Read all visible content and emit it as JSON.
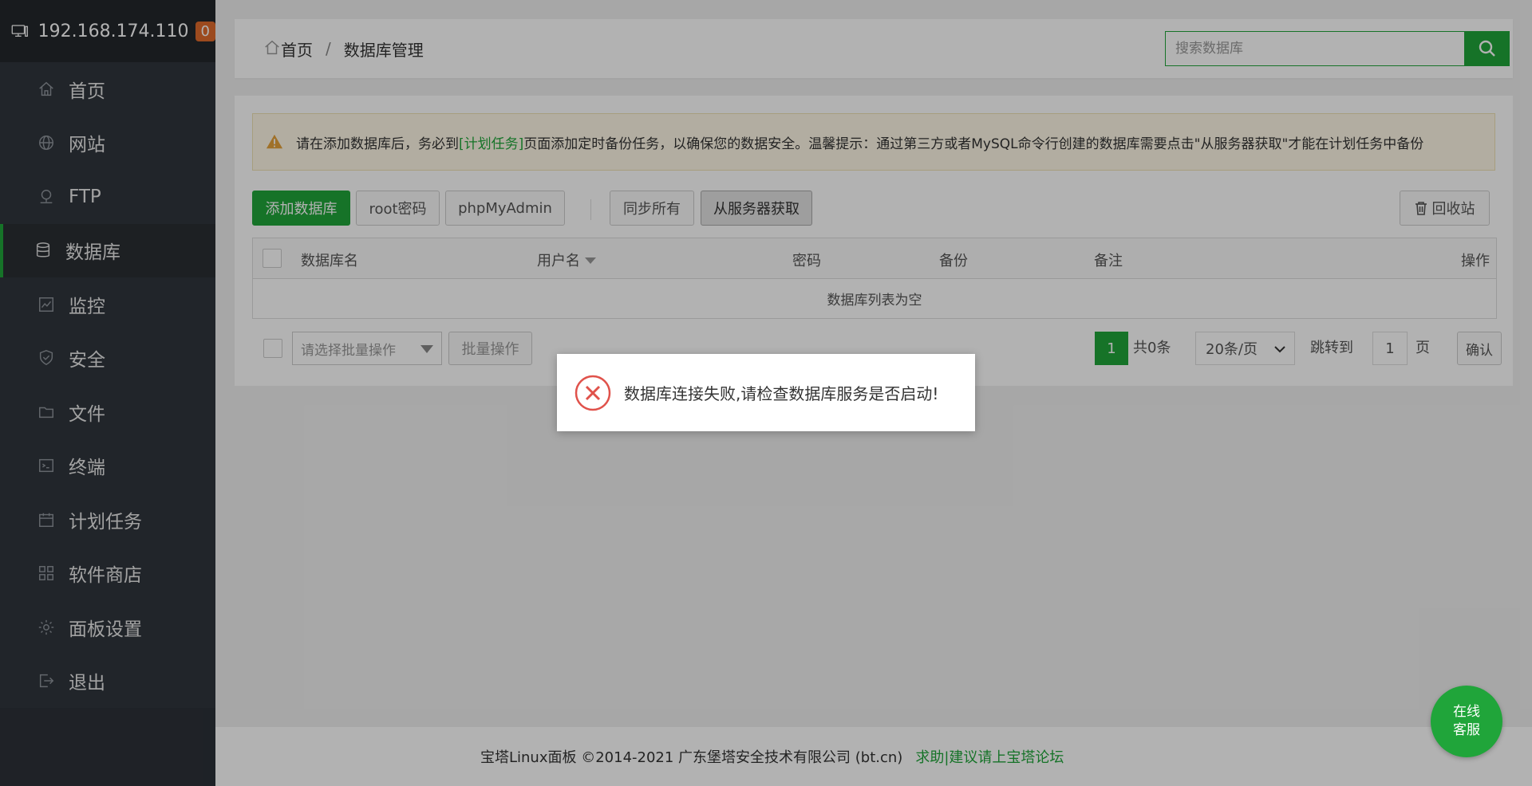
{
  "header": {
    "ip": "192.168.174.110",
    "badge_count": "0"
  },
  "menu": [
    {
      "label": "首页",
      "icon": "home-icon"
    },
    {
      "label": "网站",
      "icon": "globe-icon"
    },
    {
      "label": "FTP",
      "icon": "ftp-icon"
    },
    {
      "label": "数据库",
      "icon": "database-icon",
      "active": true
    },
    {
      "label": "监控",
      "icon": "monitor-icon"
    },
    {
      "label": "安全",
      "icon": "shield-icon"
    },
    {
      "label": "文件",
      "icon": "folder-icon"
    },
    {
      "label": "终端",
      "icon": "terminal-icon"
    },
    {
      "label": "计划任务",
      "icon": "calendar-icon"
    },
    {
      "label": "软件商店",
      "icon": "apps-icon"
    },
    {
      "label": "面板设置",
      "icon": "gear-icon"
    },
    {
      "label": "退出",
      "icon": "logout-icon"
    }
  ],
  "breadcrumb": {
    "home": "首页",
    "separator": "/",
    "current": "数据库管理"
  },
  "search": {
    "placeholder": "搜索数据库"
  },
  "notice": {
    "prefix": "请在添加数据库后，务必到",
    "link": "[计划任务]",
    "suffix": "页面添加定时备份任务，以确保您的数据安全。温馨提示：通过第三方或者MySQL命令行创建的数据库需要点击\"从服务器获取\"才能在计划任务中备份"
  },
  "toolbar": {
    "add_db": "添加数据库",
    "root_pw": "root密码",
    "phpmyadmin": "phpMyAdmin",
    "sync_all": "同步所有",
    "fetch_from_server": "从服务器获取",
    "recycle_bin": "回收站"
  },
  "table": {
    "columns": [
      "数据库名",
      "用户名",
      "密码",
      "备份",
      "备注",
      "操作"
    ],
    "empty_text": "数据库列表为空"
  },
  "batch": {
    "select_placeholder": "请选择批量操作",
    "apply": "批量操作"
  },
  "pagination": {
    "current_page": "1",
    "total": "共0条",
    "page_size": "20条/页",
    "jump_label": "跳转到",
    "jump_value": "1",
    "page_unit": "页",
    "confirm": "确认"
  },
  "footer": {
    "copyright": "宝塔Linux面板 ©2014-2021 广东堡塔安全技术有限公司 (bt.cn)",
    "help_link": "求助|建议请上宝塔论坛"
  },
  "dialog": {
    "message": "数据库连接失败,请检查数据库服务是否启动!"
  },
  "chat": {
    "line1": "在线",
    "line2": "客服"
  },
  "colors": {
    "accent": "#20a53a",
    "sidebar": "#2c3138",
    "error": "#e0524b",
    "badge": "#e06a2b"
  }
}
